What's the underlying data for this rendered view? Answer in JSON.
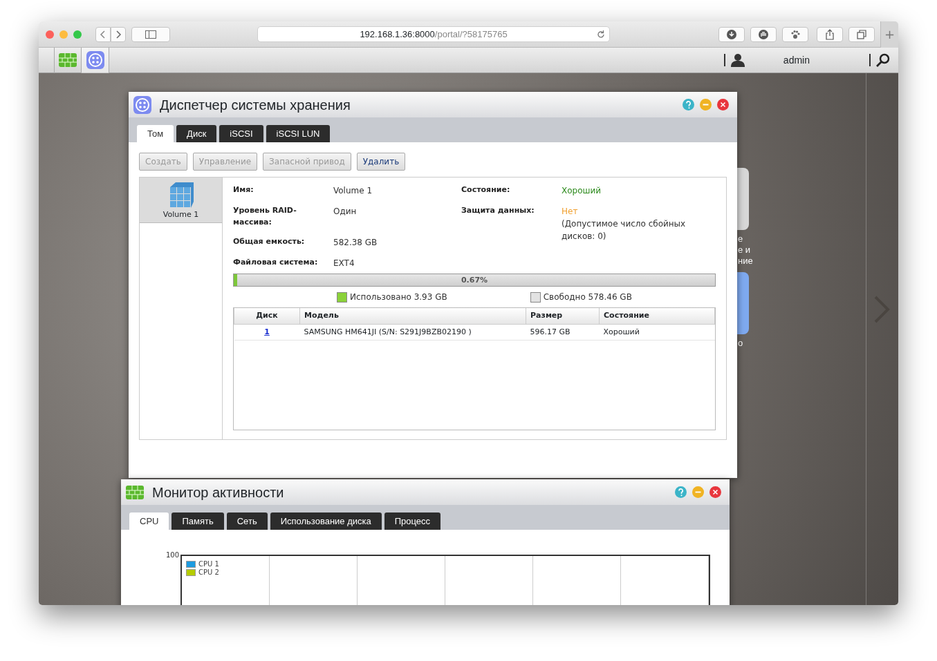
{
  "browser": {
    "url_host": "192.168.1.36:8000",
    "url_path": "/portal/?58175765"
  },
  "new_tab": "+",
  "topbar": {
    "user": "admin"
  },
  "desktop_icons": [
    {
      "label_lines": [
        "е",
        "е и",
        "ние"
      ]
    },
    {
      "label_lines": [
        "о"
      ]
    }
  ],
  "storage_window": {
    "title": "Диспетчер системы хранения",
    "tabs": [
      {
        "label": "Том",
        "selected": true
      },
      {
        "label": "Диск",
        "selected": false
      },
      {
        "label": "iSCSI",
        "selected": false
      },
      {
        "label": "iSCSI LUN",
        "selected": false
      }
    ],
    "buttons": [
      {
        "label": "Создать",
        "disabled": true
      },
      {
        "label": "Управление",
        "disabled": true
      },
      {
        "label": "Запасной привод",
        "disabled": true
      },
      {
        "label": "Удалить",
        "disabled": false
      }
    ],
    "volumes": [
      {
        "name": "Volume 1",
        "selected": true
      }
    ],
    "details_left": [
      {
        "label": "Имя:",
        "value": "Volume 1"
      },
      {
        "label": "Уровень RAID-массива:",
        "value": "Один"
      },
      {
        "label": "Общая емкость:",
        "value": "582.38 GB"
      },
      {
        "label": "Файловая система:",
        "value": "EXT4"
      }
    ],
    "details_right": [
      {
        "label": "Состояние:",
        "value": "Хороший",
        "color": "#2e8b1e"
      },
      {
        "label": "Защита данных:",
        "value": "Нет",
        "color": "#f0a030",
        "note": "(Допустимое число сбойных дисков: 0)"
      }
    ],
    "usage": {
      "level": 0.0067,
      "reading": "0.67%",
      "used": "Использовано 3.93 GB",
      "free": "Свободно 578.46 GB"
    },
    "disk_table": {
      "columns": [
        "Диск",
        "Модель",
        "Размер",
        "Состояние"
      ],
      "rows": [
        [
          "1",
          "SAMSUNG HM641JI (S/N: S291J9BZB02190 )",
          "596.17 GB",
          "Хороший"
        ]
      ]
    }
  },
  "activity_window": {
    "title": "Монитор активности",
    "tabs": [
      {
        "label": "CPU",
        "selected": true
      },
      {
        "label": "Память",
        "selected": false
      },
      {
        "label": "Сеть",
        "selected": false
      },
      {
        "label": "Использование диска",
        "selected": false
      },
      {
        "label": "Процесс",
        "selected": false
      }
    ],
    "chart": {
      "ytick": "100",
      "legend": [
        {
          "name": "CPU 1",
          "color": "#1e9be0"
        },
        {
          "name": "CPU 2",
          "color": "#b5cc00"
        }
      ]
    }
  }
}
